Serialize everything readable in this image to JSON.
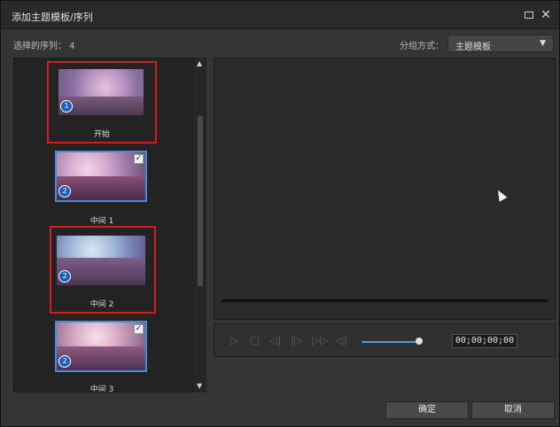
{
  "window": {
    "title": "添加主题模板/序列"
  },
  "header": {
    "selected_count_text": "选择的序列：  4",
    "group_by_label": "分组方式：",
    "group_by_value": "主题模板"
  },
  "items": [
    {
      "label": "开始",
      "badge": "1",
      "checked": false,
      "highlighted": true
    },
    {
      "label": "中间 1",
      "badge": "2",
      "checked": true,
      "highlighted": false
    },
    {
      "label": "中间 2",
      "badge": "2",
      "checked": false,
      "highlighted": true
    },
    {
      "label": "中间 3",
      "badge": "2",
      "checked": true,
      "highlighted": false
    }
  ],
  "player": {
    "timecode": "00;00;00;00",
    "volume_fraction": 0.95
  },
  "footer": {
    "ok_label": "确定",
    "cancel_label": "取消"
  },
  "colors": {
    "highlight_red": "#d41e1e",
    "selection_blue": "#3b8ee0",
    "badge_blue": "#1e5fb8",
    "volume_blue": "#4a9be8"
  }
}
